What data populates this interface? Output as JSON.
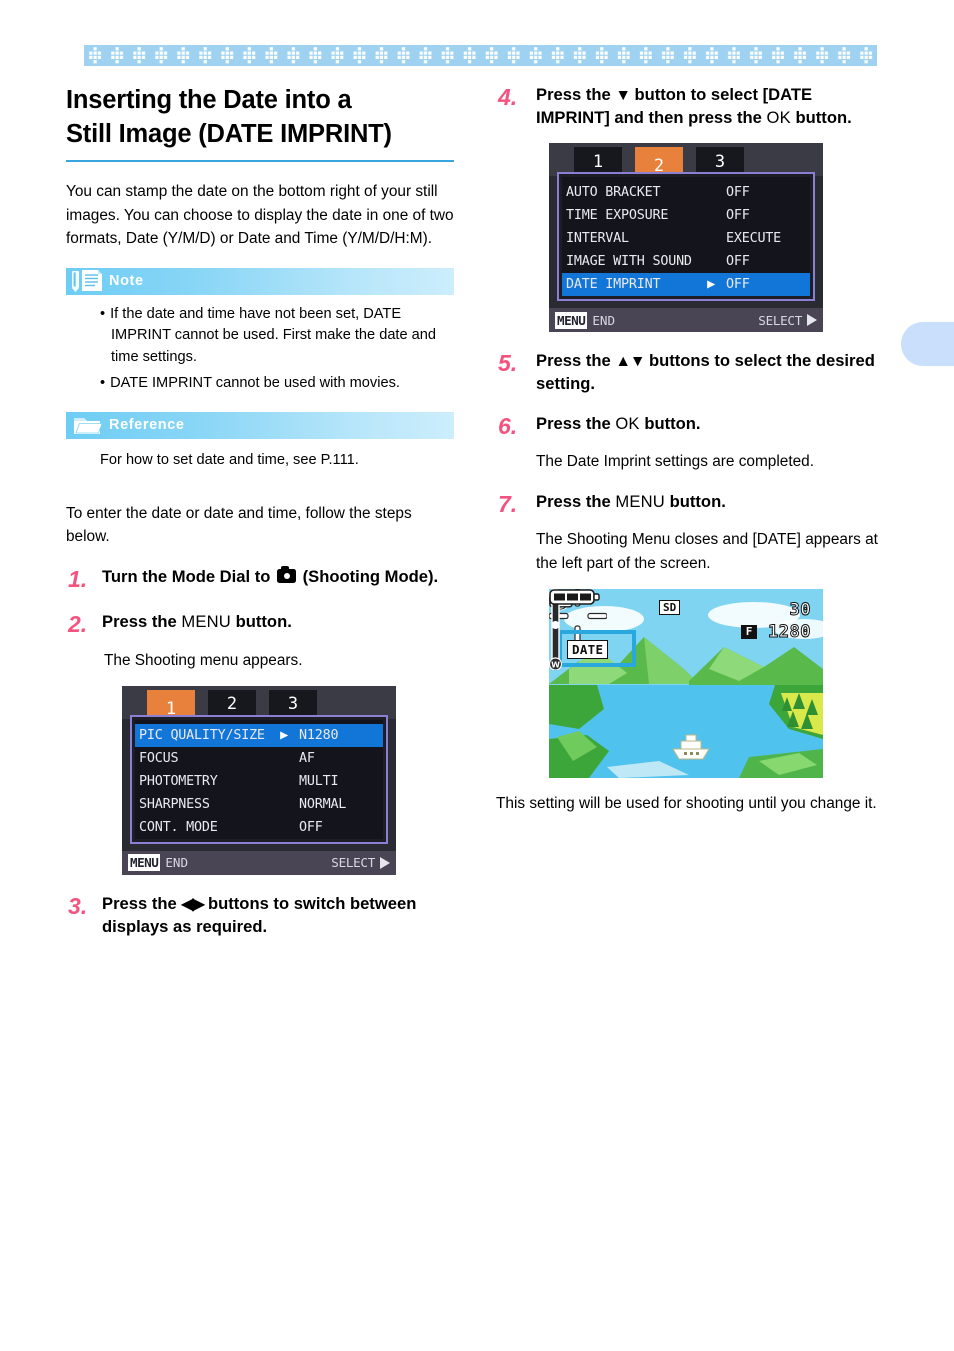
{
  "page": {
    "title_line1": "Inserting the Date into a",
    "title_line2": "Still Image (DATE IMPRINT)",
    "intro": "You can stamp the date on the bottom right of your still images. You can choose to display the date in one of two formats, Date (Y/M/D) or Date and Time (Y/M/D/H:M).",
    "lead_in": "To enter the date or date and time, follow the steps below.",
    "accent_blue": "#3aa6e0",
    "accent_pink": "#f4537f",
    "band_blue": "#9ed2f0",
    "tab_blue": "#cadffb"
  },
  "note": {
    "label": "Note",
    "icon": "note-pencil-icon",
    "items": [
      "If the date and time have not been set, DATE IMPRINT cannot be used. First make the date and time settings.",
      "DATE IMPRINT cannot be used with movies."
    ]
  },
  "reference": {
    "label": "Reference",
    "icon": "folder-icon",
    "text": "For how to set date and time, see P.111."
  },
  "steps_left": [
    {
      "num": "1.",
      "text_before": "Turn the Mode Dial to ",
      "icon": "camera-mode-icon",
      "text_after": " (Shooting Mode)."
    },
    {
      "num": "2.",
      "text_before": "Press the ",
      "token": "MENU",
      "text_after": " button.",
      "sub": "The Shooting menu appears."
    },
    {
      "num": "3.",
      "text_before": "Press the ",
      "token": "◀▶",
      "text_after": " buttons to switch between displays as required."
    }
  ],
  "steps_right": [
    {
      "num": "4.",
      "text_before": "Press the ",
      "token": "▼",
      "text_mid": " button to select [DATE IMPRINT] and then press the ",
      "token2": "OK",
      "text_after": " button."
    },
    {
      "num": "5.",
      "text_before": "Press the ",
      "token": "▲▼",
      "text_after": " buttons to select the desired setting."
    },
    {
      "num": "6.",
      "text_before": "Press the ",
      "token": "OK",
      "text_after": " button.",
      "sub": "The Date Imprint settings are completed."
    },
    {
      "num": "7.",
      "text_before": "Press the ",
      "token": "MENU",
      "text_after": " button.",
      "sub": "The Shooting Menu closes and [DATE] appears at the left part of the screen."
    }
  ],
  "closing_text": "This setting will be used for shooting until you change it.",
  "lcd_shooting_menu": {
    "tabs": [
      "1",
      "2",
      "3"
    ],
    "active_tab": "1",
    "rows": [
      {
        "name": "PIC QUALITY/SIZE",
        "arrow": "▶",
        "value": "N1280",
        "selected": true
      },
      {
        "name": "FOCUS",
        "arrow": "",
        "value": "AF",
        "selected": false
      },
      {
        "name": "PHOTOMETRY",
        "arrow": "",
        "value": "MULTI",
        "selected": false
      },
      {
        "name": "SHARPNESS",
        "arrow": "",
        "value": "NORMAL",
        "selected": false
      },
      {
        "name": "CONT. MODE",
        "arrow": "",
        "value": "OFF",
        "selected": false
      }
    ],
    "footer_badge": "MENU",
    "footer_left": "END",
    "footer_right": "SELECT"
  },
  "lcd_date_imprint_menu": {
    "tabs": [
      "1",
      "2",
      "3"
    ],
    "active_tab": "2",
    "rows": [
      {
        "name": "AUTO BRACKET",
        "arrow": "",
        "value": "OFF",
        "selected": false
      },
      {
        "name": "TIME EXPOSURE",
        "arrow": "",
        "value": "OFF",
        "selected": false
      },
      {
        "name": "INTERVAL",
        "arrow": "",
        "value": "EXECUTE",
        "selected": false
      },
      {
        "name": "IMAGE WITH SOUND",
        "arrow": "",
        "value": "OFF",
        "selected": false
      },
      {
        "name": "DATE IMPRINT",
        "arrow": "▶",
        "value": "OFF",
        "selected": true
      }
    ],
    "footer_badge": "MENU",
    "footer_left": "END",
    "footer_right": "SELECT"
  },
  "lcd_live_view": {
    "date_badge": "DATE",
    "sd_badge": "SD",
    "shots_remaining": "30",
    "quality_badge": "F",
    "resolution": "1280",
    "zoom_top_label": "T",
    "zoom_bottom_label": "W",
    "flash_icon": "flash-off-icon",
    "camera_icon": "camera-icon",
    "battery_icon": "battery-icon",
    "highlight_color": "#29a8e0"
  }
}
